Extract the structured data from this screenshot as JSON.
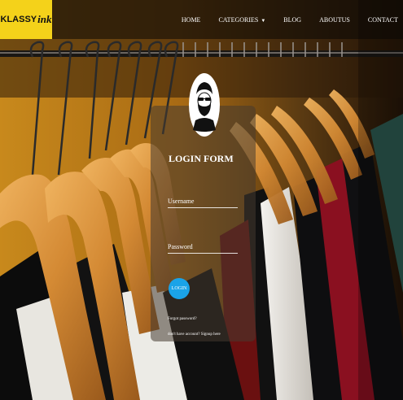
{
  "logo": {
    "brand": "KLASSY",
    "ink": "ink"
  },
  "nav": {
    "items": [
      {
        "label": "HOME"
      },
      {
        "label": "CATEGORIES",
        "has_dropdown": true
      },
      {
        "label": "BLOG"
      },
      {
        "label": "ABOUTUS"
      },
      {
        "label": "CONTACT"
      }
    ]
  },
  "login": {
    "title": "LOGIN FORM",
    "username_label": "Username",
    "password_label": "Password",
    "button_label": "LOGIN",
    "forgot_label": "Forgot password?",
    "signup_label": "don't have account? Signup here"
  },
  "colors": {
    "logo_bg": "#f4d21a",
    "button": "#1aa3e8"
  }
}
